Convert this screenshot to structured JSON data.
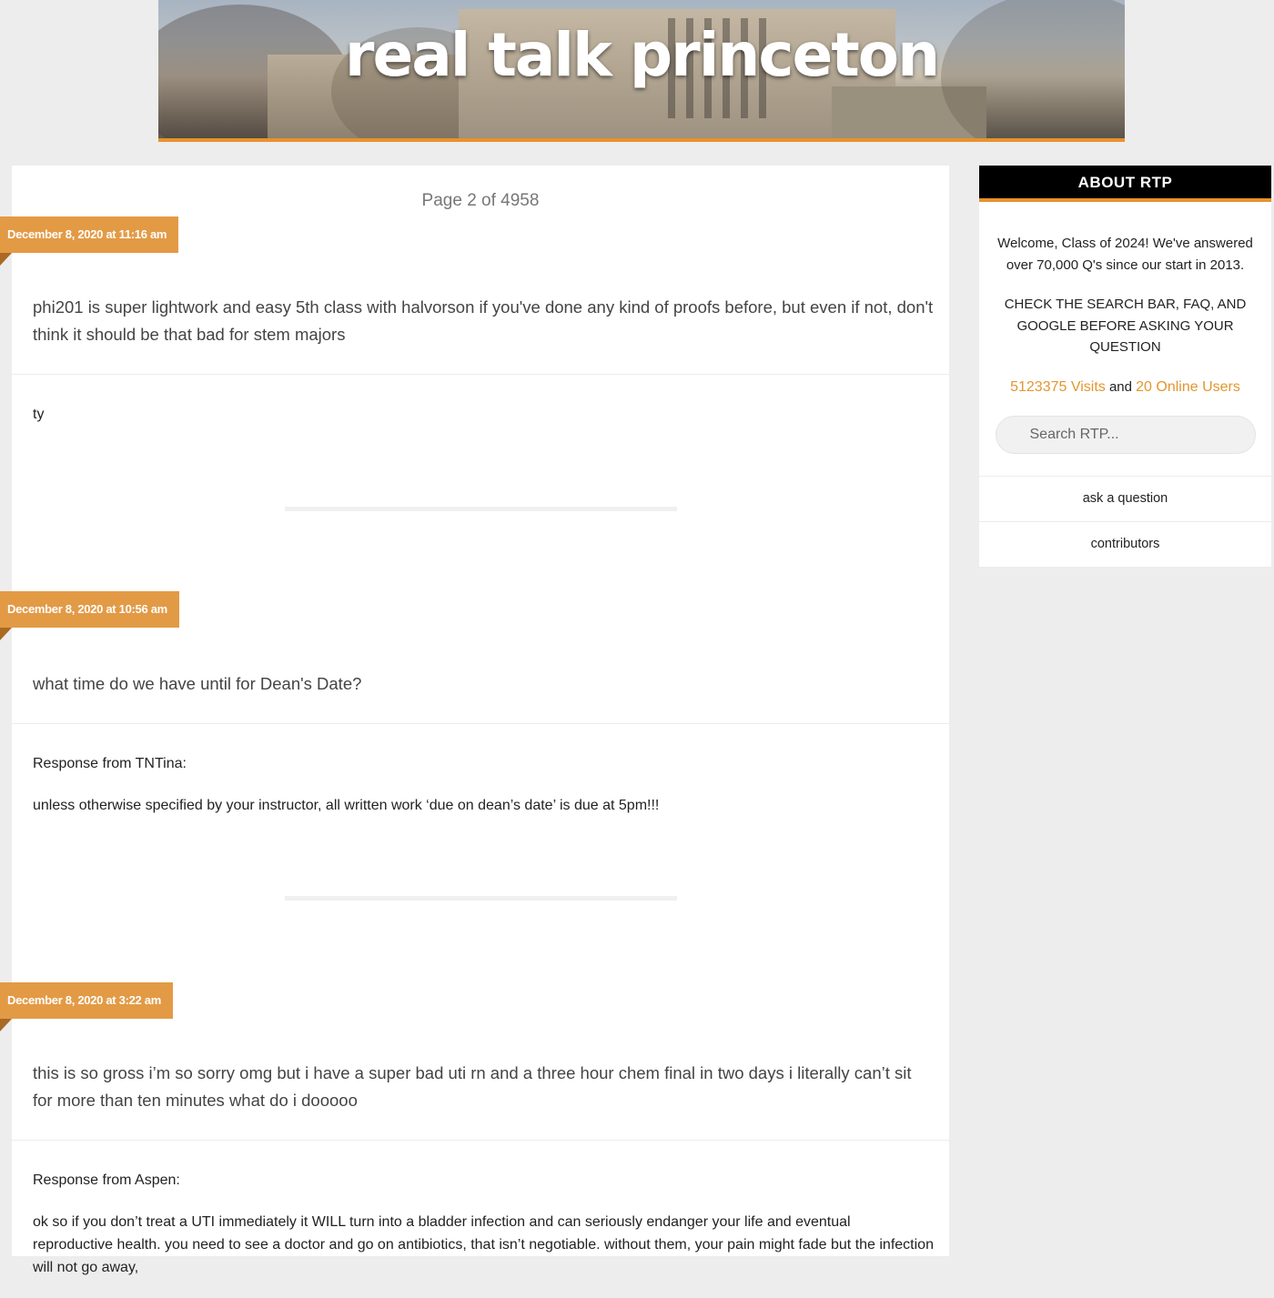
{
  "header": {
    "title": "real talk princeton"
  },
  "main": {
    "page_indicator": "Page 2 of 4958",
    "posts": [
      {
        "date": "December 8, 2020 at 11:16 am",
        "question": "phi201 is super lightwork and easy 5th class with halvorson if you've done any kind of proofs before, but even if not, don't think it should be that bad for stem majors",
        "response_from": "",
        "response_paragraphs": [
          "ty"
        ]
      },
      {
        "date": "December 8, 2020 at 10:56 am",
        "question": "what time do we have until for Dean's Date?",
        "response_from": "Response from TNTina:",
        "response_paragraphs": [
          "unless otherwise specified by your instructor, all written work ‘due on dean’s date’ is due at 5pm!!!"
        ]
      },
      {
        "date": "December 8, 2020 at 3:22 am",
        "question": "this is so gross i’m so sorry omg but i have a super bad uti rn and a three hour chem final in two days i literally can’t sit for more than ten minutes what do i dooooo",
        "response_from": "Response from Aspen:",
        "response_paragraphs": [
          "ok so if you don’t treat a UTI immediately it WILL turn into a bladder infection and can seriously endanger your life and eventual reproductive health. you need to see a doctor and go on antibiotics, that isn’t negotiable. without them, your pain might fade but the infection will not go away,"
        ]
      }
    ]
  },
  "sidebar": {
    "title": "ABOUT RTP",
    "welcome": "Welcome, Class of 2024! We've answered over 70,000 Q's since our start in 2013.",
    "notice": "CHECK THE SEARCH BAR, FAQ, AND GOOGLE BEFORE ASKING YOUR QUESTION",
    "visits": "5123375 Visits",
    "and": "and",
    "online": "20 Online Users",
    "search_placeholder": "Search RTP...",
    "links": [
      "ask a question",
      "contributors"
    ]
  },
  "colors": {
    "accent": "#e8922e",
    "date_tag": "#e39a45",
    "widget_head": "#000000",
    "background": "#ededed"
  }
}
